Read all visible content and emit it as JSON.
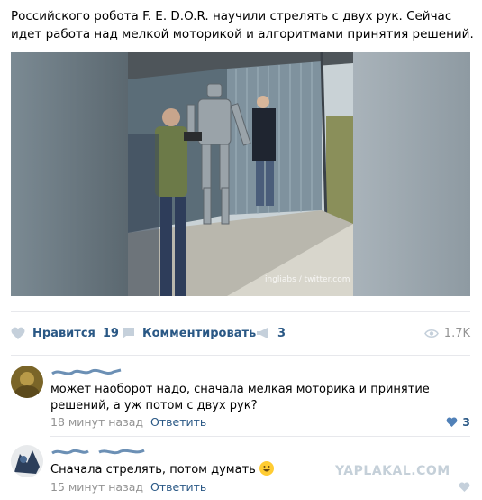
{
  "post": {
    "text": "Российского робота F. E. D.O.R. научили стрелять с двух рук. Сейчас идет работа над мелкой моторикой и алгоритмами принятия решений.",
    "photo_watermark": "ingliabs / twitter.com"
  },
  "actions": {
    "like_label": "Нравится",
    "like_count": "19",
    "comment_label": "Комментировать",
    "share_count": "3",
    "views": "1.7K",
    "accent_color": "#2a5885"
  },
  "comments": [
    {
      "text": "может наоборот надо, сначала мелкая моторика и принятие решений, а уж потом с двух рук?",
      "time": "18 минут назад",
      "reply_label": "Ответить",
      "likes": "3"
    },
    {
      "text": "Сначала стрелять, потом думать",
      "time": "15 минут назад",
      "reply_label": "Ответить"
    }
  ],
  "watermark": "YAPLAKAL.COM"
}
